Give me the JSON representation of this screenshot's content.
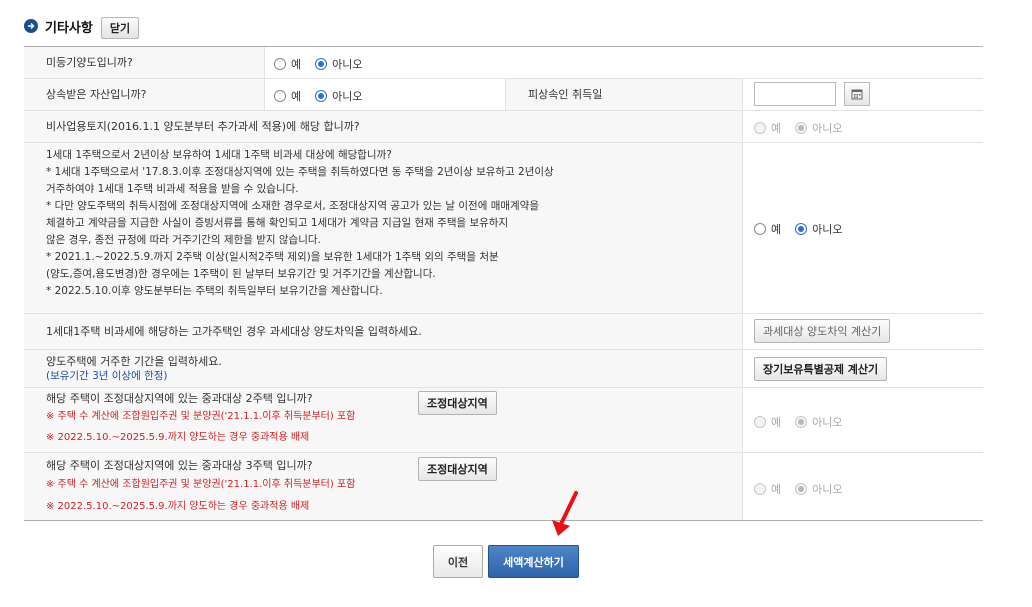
{
  "section": {
    "title": "기타사항",
    "close_label": "닫기"
  },
  "rows": {
    "r1": {
      "question": "미등기양도입니까?",
      "yes": "예",
      "no": "아니오"
    },
    "r2": {
      "question": "상속받은 자산입니까?",
      "yes": "예",
      "no": "아니오",
      "date_label": "피상속인 취득일"
    },
    "r3": {
      "question": "비사업용토지(2016.1.1 양도분부터 추가과세 적용)에 해당 합니까?",
      "yes": "예",
      "no": "아니오"
    },
    "r4": {
      "lines": [
        "1세대 1주택으로서 2년이상 보유하여 1세대 1주택 비과세 대상에 해당합니까?",
        "* 1세대 1주택으로서 '17.8.3.이후 조정대상지역에 있는 주택을 취득하였다면 동 주택을 2년이상 보유하고 2년이상",
        "거주하여야 1세대 1주택 비과세 적용을 받을 수 있습니다.",
        "* 다만 양도주택의 취득시점에 조정대상지역에 소재한 경우로서, 조정대상지역 공고가 있는 날 이전에 매매계약을",
        "체결하고 계약금을 지급한 사실이 증빙서류를 통해 확인되고 1세대가 계약금 지급일 현재 주택을 보유하지",
        "않은 경우, 종전 규정에 따라 거주기간의 제한을 받지 않습니다.",
        "* 2021.1.~2022.5.9.까지 2주택 이상(일시적2주택 제외)을 보유한 1세대가 1주택 외의 주택을 처분",
        "(양도,증여,용도변경)한 경우에는 1주택이 된 날부터 보유기간 및 거주기간을 계산합니다.",
        "* 2022.5.10.이후 양도분부터는 주택의 취득일부터 보유기간을 계산합니다."
      ],
      "yes": "예",
      "no": "아니오"
    },
    "r5": {
      "question": "1세대1주택 비과세에 해당하는 고가주택인 경우 과세대상 양도차익을 입력하세요.",
      "button": "과세대상 양도차익 계산기"
    },
    "r6": {
      "question": "양도주택에 거주한 기간을 입력하세요.",
      "note": "(보유기간 3년 이상에 한정)",
      "button": "장기보유특별공제 계산기"
    },
    "r7": {
      "question": "해당 주택이 조정대상지역에 있는 중과대상 2주택 입니까?",
      "button": "조정대상지역",
      "note1": "※ 주택 수 계산에 조합원입주권 및 분양권('21.1.1.이후 취득분부터) 포함",
      "note2": "※ 2022.5.10.~2025.5.9.까지 양도하는 경우 중과적용 배제",
      "yes": "예",
      "no": "아니오"
    },
    "r8": {
      "question": "해당 주택이 조정대상지역에 있는 중과대상 3주택 입니까?",
      "button": "조정대상지역",
      "note1": "※ 주택 수 계산에 조합원입주권 및 분양권('21.1.1.이후 취득분부터) 포함",
      "note2": "※ 2022.5.10.~2025.5.9.까지 양도하는 경우 중과적용 배제",
      "yes": "예",
      "no": "아니오"
    }
  },
  "footer": {
    "prev_label": "이전",
    "calc_label": "세액계산하기"
  },
  "colors": {
    "accent": "#2d64ab",
    "note_red": "#d22020",
    "arrow_red": "#e8101a"
  }
}
